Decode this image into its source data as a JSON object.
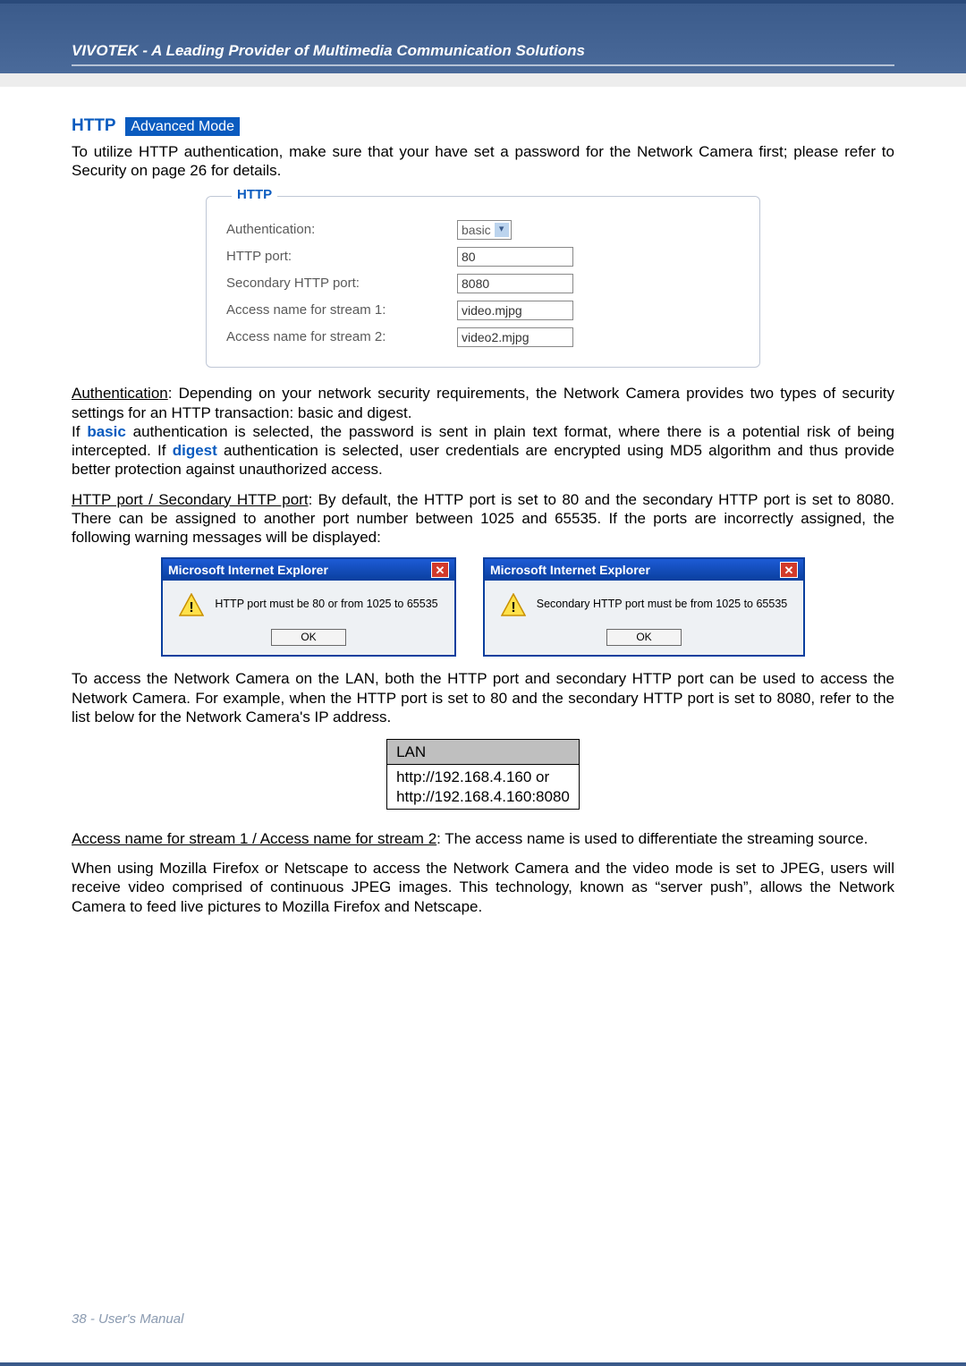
{
  "header": {
    "tagline": "VIVOTEK - A Leading Provider of Multimedia Communication Solutions"
  },
  "section": {
    "http_label": "HTTP",
    "adv_mode": "Advanced Mode",
    "intro": "To utilize HTTP authentication, make sure that your have set a password for the Network Camera first; please refer to Security on page 26 for details."
  },
  "http_form": {
    "legend": "HTTP",
    "rows": {
      "auth_label": "Authentication:",
      "auth_value": "basic",
      "port_label": "HTTP port:",
      "port_value": "80",
      "secport_label": "Secondary HTTP port:",
      "secport_value": "8080",
      "stream1_label": "Access name for stream 1:",
      "stream1_value": "video.mjpg",
      "stream2_label": "Access name for stream 2:",
      "stream2_value": "video2.mjpg"
    }
  },
  "auth_para": {
    "lead": "Authentication",
    "rest1": ": Depending on your network security requirements, the Network Camera provides two types of security settings for an HTTP transaction: basic and digest.",
    "line2a": "If ",
    "basic": "basic",
    "line2b": " authentication is selected, the password is sent in plain text format, where there is a potential risk of being intercepted. If ",
    "digest": "digest",
    "line2c": " authentication is selected, user credentials are encrypted using MD5 algorithm and thus provide better protection against unauthorized access."
  },
  "port_para": {
    "lead": "HTTP port / Secondary HTTP port",
    "rest": ": By default, the HTTP port is set to 80 and the secondary HTTP port is set to 8080. There can be assigned to another port number between 1025 and 65535. If the ports are incorrectly assigned, the following warning messages will be displayed:"
  },
  "dialogs": {
    "title": "Microsoft Internet Explorer",
    "msg1": "HTTP port must be 80 or from 1025 to 65535",
    "msg2": "Secondary HTTP port must be from 1025 to 65535",
    "ok": "OK"
  },
  "lan_para": "To access the Network Camera on the LAN, both the HTTP port and secondary HTTP port can be used to access the Network Camera. For example, when the HTTP port is set to 80 and the secondary HTTP port is set to 8080, refer to the list below for the Network Camera's IP address.",
  "lan_table": {
    "header": "LAN",
    "row1": "http://192.168.4.160  or",
    "row2": "http://192.168.4.160:8080"
  },
  "access_para": {
    "lead": "Access name for stream 1 / Access name for stream 2",
    "rest": ": The access name is used to differentiate the streaming source."
  },
  "firefox_para": "When using Mozilla Firefox or Netscape to access the Network Camera and the video mode is set to JPEG, users will receive video comprised of continuous JPEG images. This technology, known as “server push”, allows the Network Camera to feed live pictures to Mozilla Firefox and Netscape.",
  "footer": "38 - User's Manual"
}
